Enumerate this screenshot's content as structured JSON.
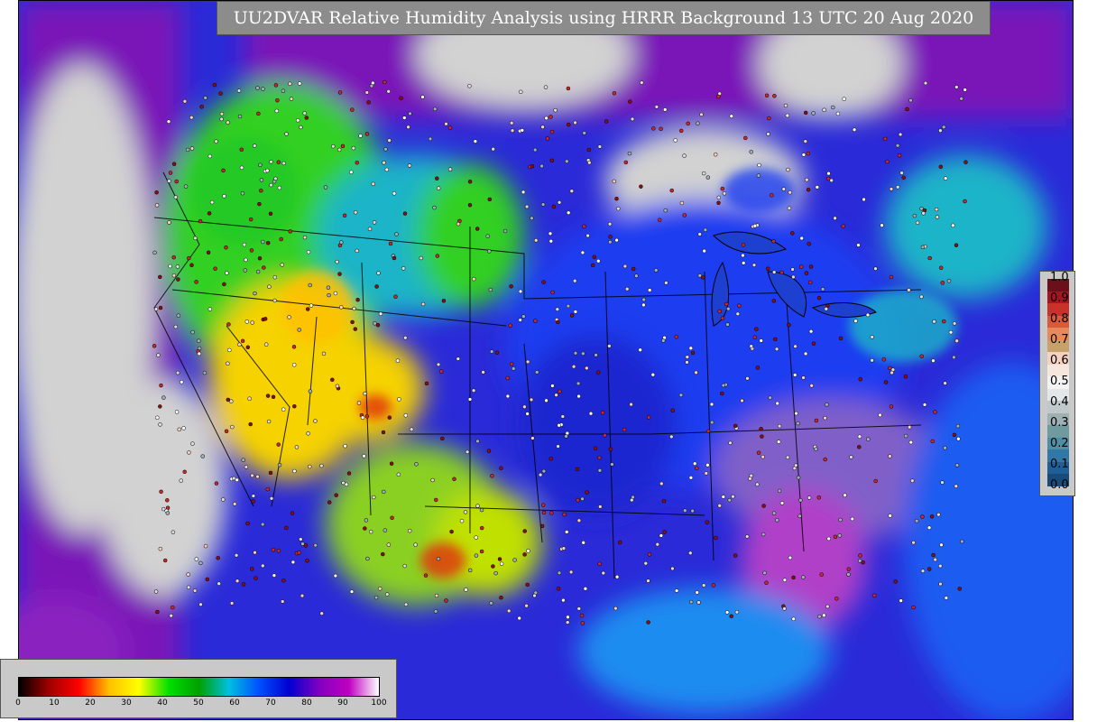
{
  "title": "UU2DVAR Relative Humidity Analysis using HRRR Background 13 UTC 20 Aug 2020",
  "rh_colorbar": {
    "ticks": [
      "0",
      "10",
      "20",
      "30",
      "40",
      "50",
      "60",
      "70",
      "80",
      "90",
      "100"
    ],
    "stops": [
      "#000000",
      "#a00000",
      "#ff0000",
      "#ffc000",
      "#ffff00",
      "#00e000",
      "#00a000",
      "#00c0e0",
      "#0050ff",
      "#0000d0",
      "#8000c0",
      "#c000c0",
      "#ffffff"
    ]
  },
  "value_colorbar": {
    "ticks": [
      "1.0",
      "0.9",
      "0.8",
      "0.7",
      "0.6",
      "0.5",
      "0.4",
      "0.3",
      "0.2",
      "0.1",
      "0.0"
    ],
    "colors": [
      "#6b0f1a",
      "#a5141f",
      "#c8322b",
      "#d95a3a",
      "#e8895a",
      "#c8a06a",
      "#f5d1c0",
      "#f6e6de",
      "#f3f3f3",
      "#e4e7ea",
      "#c0c8cc",
      "#9fb0b4",
      "#6f9aa0",
      "#4f8fa6",
      "#2f78a8",
      "#1f5f96",
      "#184a7a"
    ]
  },
  "colors": {
    "ocean_pacific": "#7a18b8",
    "land_gray": "#d2d2d2",
    "moist_blue": "#1e3cf0",
    "dry_yellow": "#f5d200",
    "dry_green": "#32d020",
    "teal": "#1eb4c8"
  },
  "icons": [
    "station-dot-icon"
  ]
}
